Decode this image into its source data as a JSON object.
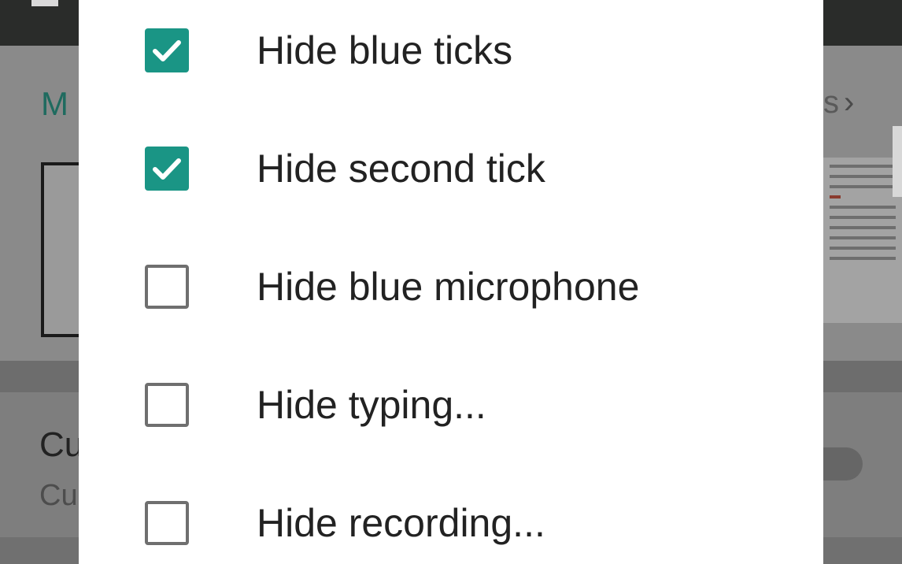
{
  "background": {
    "link_fragment": "M",
    "right_fragment": "s",
    "section_title_fragment": "Cu",
    "section_subtitle_fragment": "Cu",
    "chevron": "›"
  },
  "dialog": {
    "options": [
      {
        "label": "Hide blue ticks",
        "checked": true
      },
      {
        "label": "Hide second tick",
        "checked": true
      },
      {
        "label": "Hide blue microphone",
        "checked": false
      },
      {
        "label": "Hide typing...",
        "checked": false
      },
      {
        "label": "Hide recording...",
        "checked": false
      }
    ]
  },
  "colors": {
    "accent": "#1a9585",
    "checkbox_border": "#6f6f6f",
    "text": "#222222"
  }
}
